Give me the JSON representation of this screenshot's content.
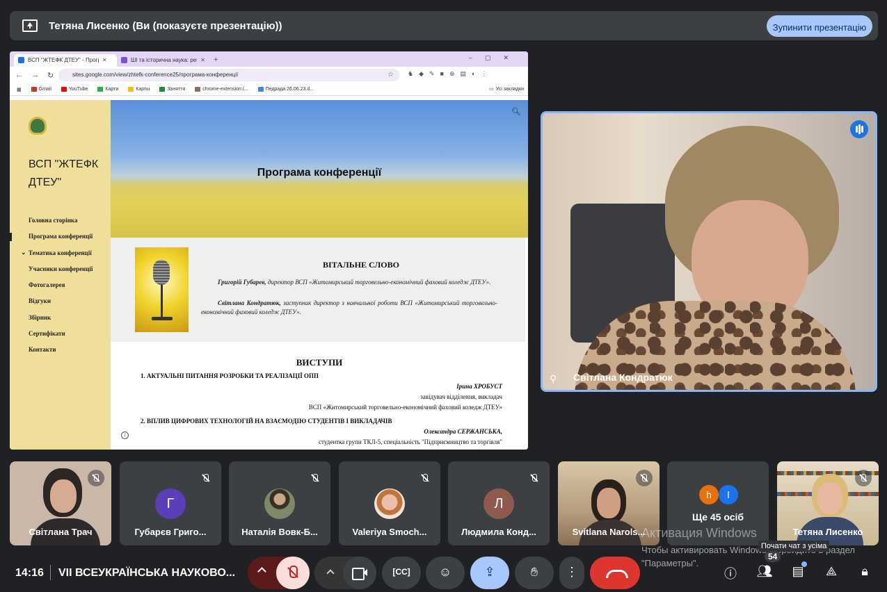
{
  "banner": {
    "title": "Тетяна Лисенко (Ви (показуєте презентацію))",
    "stop_label": "Зупинити презентацію"
  },
  "browser": {
    "tabs": [
      {
        "label": "ВСП \"ЖТЕФК ДТЕУ\" - Програм",
        "color": "#1a73e8"
      },
      {
        "label": "ШІ та історична наука: револ",
        "color": "#7b4fd6"
      }
    ],
    "url": "sites.google.com/view/zhtefk-conference25/програма-конференції",
    "bookmarks": [
      {
        "label": "Gmail",
        "color": "#d93025"
      },
      {
        "label": "YouTube",
        "color": "#ff0000"
      },
      {
        "label": "Карти",
        "color": "#34a853"
      },
      {
        "label": "Карты",
        "color": "#fbbc04"
      },
      {
        "label": "Заняття",
        "color": "#1e8e3e"
      },
      {
        "label": "chrome-extension:/...",
        "color": "#8d6e63"
      },
      {
        "label": "Педрада 26.06.23.d...",
        "color": "#4285f4"
      }
    ],
    "all_bookmarks": "Усі закладки"
  },
  "site": {
    "title": "ВСП \"ЖТЕФК ДТЕУ\"",
    "menu": [
      "Головна сторінка",
      "Програма конференції",
      "Тематика конференції",
      "Учасники конференції",
      "Фотогалерея",
      "Відгуки",
      "Збірник",
      "Сертифікати",
      "Контакти"
    ],
    "current_menu": 1,
    "hero_title": "Програма конференції",
    "greeting_title": "ВІТАЛЬНЕ СЛОВО",
    "greeting": [
      {
        "name": "Григорій Губарев,",
        "text": " директор ВСП «Житомирський торговельно-економічний фаховий коледж ДТЕУ»."
      },
      {
        "name": "Світлана Кондратюк,",
        "text": " заступник директор з навчальної роботи ВСП «Житомирський торговельно-економічний фаховий коледж ДТЕУ»."
      }
    ],
    "talks_title": "ВИСТУПИ",
    "talks": [
      {
        "kind": "h",
        "text": "1. АКТУАЛЬНІ ПИТАННЯ РОЗРОБКИ ТА РЕАЛІЗАЦІЇ ОПП"
      },
      {
        "kind": "rb",
        "text": "Ірина ХРОБУСТ"
      },
      {
        "kind": "r",
        "text": "завідувач відділення, викладач"
      },
      {
        "kind": "r",
        "text": "ВСП «Житомирський торговельно-економічний фаховий коледж ДТЕУ»"
      },
      {
        "kind": "h",
        "text": "2. ВПЛИВ ЦИФРОВИХ ТЕХНОЛОГІЙ НА ВЗАЄМОДІЮ СТУДЕНТІВ І ВИКЛАДАЧІВ"
      },
      {
        "kind": "rb",
        "text": "Олександра СЕРЖАНСЬКА,"
      },
      {
        "kind": "r",
        "text": "студентка групи ТКЛ-5, спеціальність \"Підприємництво та торгівля\""
      }
    ]
  },
  "speaker": {
    "name": "Світлана Кондратюк"
  },
  "participants": [
    {
      "name": "Світлана Трач",
      "type": "photo",
      "color": "#c9b7a8"
    },
    {
      "name": "Губарєв Григо...",
      "type": "letter",
      "letter": "Г",
      "color": "#5b3fb8"
    },
    {
      "name": "Наталія Вовк-Б...",
      "type": "avatar-photo",
      "color": "#7c8a6a"
    },
    {
      "name": "Valeriya Smoch...",
      "type": "avatar-photo",
      "color": "#d9b48a"
    },
    {
      "name": "Людмила Конд...",
      "type": "letter",
      "letter": "Л",
      "color": "#8d5a4d"
    },
    {
      "name": "Svitlana Narols...",
      "type": "photo",
      "color": "#a58c6e"
    }
  ],
  "more": {
    "label": "Ще 45 осіб",
    "avatars": [
      {
        "letter": "h",
        "color": "#e8710a"
      },
      {
        "letter": "l",
        "color": "#1a73e8"
      }
    ]
  },
  "self_tile": {
    "name": "Тетяна Лисенко",
    "color": "#bda98a"
  },
  "bottom": {
    "time": "14:16",
    "meeting": "VII ВСЕУКРАЇНСЬКА НАУКОВО...",
    "people_count": "54",
    "chat_tooltip": "Почати чат з усіма"
  },
  "watermark": {
    "line1": "Активация Windows",
    "line2": "Чтобы активировать Windows, перейдите в раздел \"Параметры\"."
  }
}
